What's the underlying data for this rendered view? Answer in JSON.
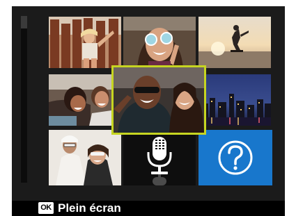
{
  "footer": {
    "ok_key": "OK",
    "action_label": "Plein écran"
  },
  "colors": {
    "selection_border": "#c6d521",
    "help_tile_background": "#1877cc",
    "screen_background": "#1b1b1b"
  },
  "grid": {
    "selected_index": 5,
    "tiles": [
      {
        "name": "photo-girl-wooden-fence"
      },
      {
        "name": "photo-woman-sunglasses-laughing"
      },
      {
        "name": "photo-skateboarder-sunset"
      },
      {
        "name": "photo-friends-lying-laughing"
      },
      {
        "name": "photo-couple-sunglasses-selfie"
      },
      {
        "name": "photo-city-skyline-night"
      },
      {
        "name": "photo-friends-white-sunglasses"
      },
      {
        "name": "voice-memo-microphone-icon"
      },
      {
        "name": "help-question-icon"
      }
    ]
  }
}
